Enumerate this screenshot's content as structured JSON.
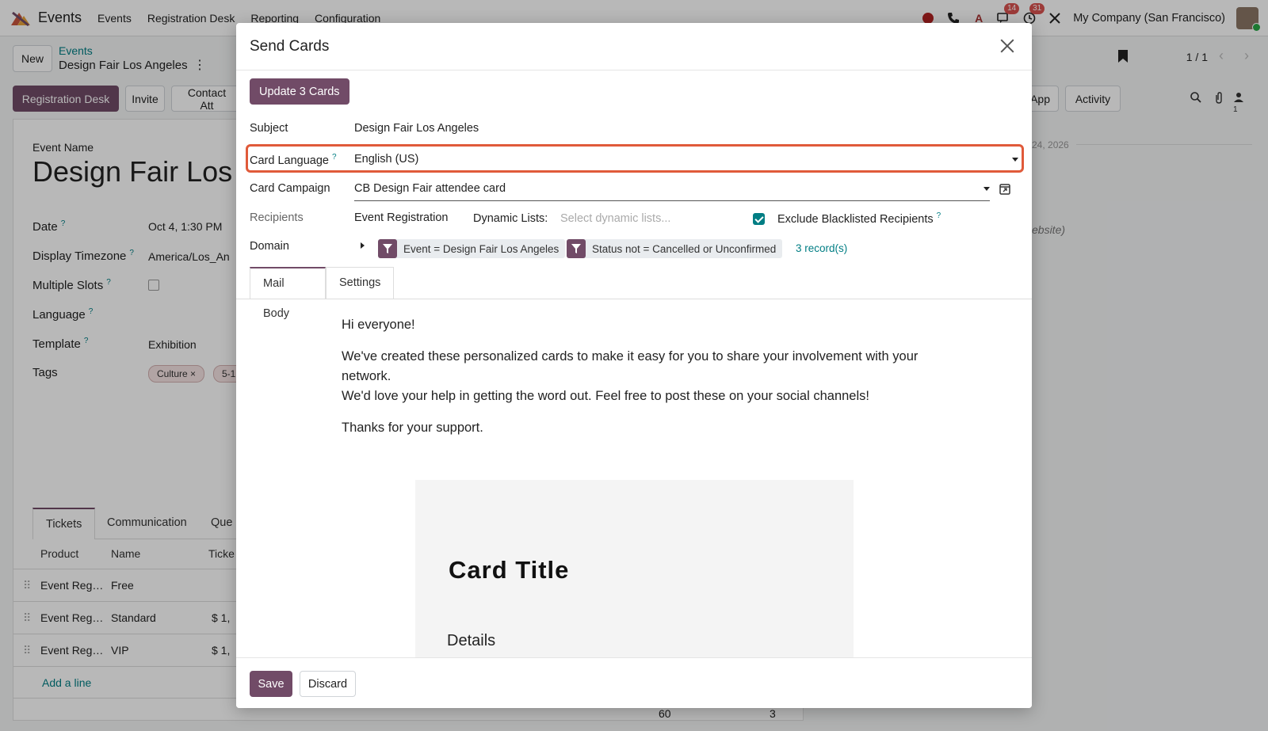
{
  "navbar": {
    "app_name": "Events",
    "menu": [
      "Events",
      "Registration Desk",
      "Reporting",
      "Configuration"
    ],
    "badges": {
      "chat": "14",
      "activity": "31"
    },
    "company": "My Company (San Francisco)"
  },
  "control": {
    "new_label": "New",
    "breadcrumb_parent": "Events",
    "breadcrumb_current": "Design Fair Los Angeles",
    "pager": "1 / 1"
  },
  "status_buttons": {
    "registration_desk": "Registration Desk",
    "invite": "Invite",
    "contact": "Contact Att",
    "whatsapp": "sApp",
    "activity": "Activity",
    "followers_count": "1"
  },
  "chatter": {
    "date": "24, 2026",
    "website_note": "ebsite)"
  },
  "form": {
    "event_name_label": "Event Name",
    "event_name": "Design Fair Los A",
    "date_label": "Date",
    "date_value": "Oct 4, 1:30 PM",
    "timezone_label": "Display Timezone",
    "timezone_value": "America/Los_An",
    "multiple_slots_label": "Multiple Slots",
    "language_label": "Language",
    "template_label": "Template",
    "template_value": "Exhibition",
    "tags_label": "Tags",
    "tags": [
      "Culture",
      "5-1"
    ],
    "help": "?"
  },
  "tickets": {
    "tabs": [
      "Tickets",
      "Communication",
      "Que"
    ],
    "columns": [
      "Product",
      "Name",
      "Ticke"
    ],
    "rows": [
      {
        "product": "Event Reg…",
        "name": "Free",
        "price": ""
      },
      {
        "product": "Event Reg…",
        "name": "Standard",
        "price": "$ 1,"
      },
      {
        "product": "Event Reg…",
        "name": "VIP",
        "price": "$ 1,"
      }
    ],
    "add_line": "Add a line",
    "totals": [
      "60",
      "3"
    ]
  },
  "modal": {
    "title": "Send Cards",
    "update_button": "Update 3 Cards",
    "subject_label": "Subject",
    "subject_value": "Design Fair Los Angeles",
    "card_language_label": "Card Language",
    "card_language_value": "English (US)",
    "card_campaign_label": "Card Campaign",
    "card_campaign_value": "CB Design Fair attendee card",
    "recipients_label": "Recipients",
    "recipients_value": "Event Registration",
    "dynamic_lists_label": "Dynamic Lists:",
    "dynamic_lists_placeholder": "Select dynamic lists...",
    "exclude_blacklisted_label": "Exclude Blacklisted Recipients",
    "exclude_blacklisted_checked": true,
    "domain_label": "Domain",
    "domain_filters": [
      "Event = Design Fair Los Angeles",
      "Status not = Cancelled or Unconfirmed"
    ],
    "domain_records": "3 record(s)",
    "tabs": [
      "Mail Body",
      "Settings"
    ],
    "mail_body": {
      "greeting": "Hi everyone!",
      "paragraph_1": "We've created these personalized cards to make it easy for you to share your involvement with your network.",
      "paragraph_2": "We'd love your help in getting the word out. Feel free to post these on your social channels!",
      "thanks": "Thanks for your support.",
      "card_title": "Card Title",
      "card_details": "Details"
    },
    "save_label": "Save",
    "discard_label": "Discard"
  },
  "colors": {
    "primary": "#714b67",
    "link": "#017e84",
    "highlight": "#e05a3a"
  }
}
